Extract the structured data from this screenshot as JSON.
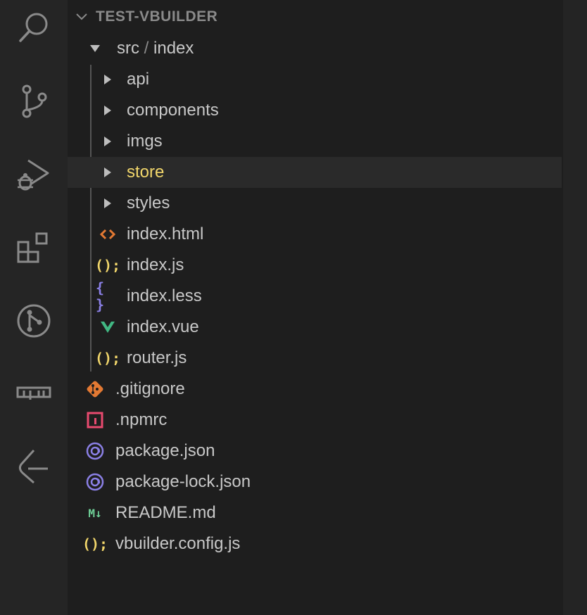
{
  "explorer": {
    "project_title": "TEST-VBUILDER",
    "folder_path": {
      "parent": "src",
      "separator": "/",
      "child": "index"
    },
    "src_children": [
      {
        "label": "api",
        "type": "folder"
      },
      {
        "label": "components",
        "type": "folder"
      },
      {
        "label": "imgs",
        "type": "folder"
      },
      {
        "label": "store",
        "type": "folder"
      },
      {
        "label": "styles",
        "type": "folder"
      },
      {
        "label": "index.html",
        "type": "file",
        "icon": "html-icon"
      },
      {
        "label": "index.js",
        "type": "file",
        "icon": "javascript-icon"
      },
      {
        "label": "index.less",
        "type": "file",
        "icon": "less-icon"
      },
      {
        "label": "index.vue",
        "type": "file",
        "icon": "vue-icon"
      },
      {
        "label": "router.js",
        "type": "file",
        "icon": "javascript-icon"
      }
    ],
    "root_files": [
      {
        "label": ".gitignore",
        "icon": "git-icon"
      },
      {
        "label": ".npmrc",
        "icon": "npm-icon"
      },
      {
        "label": "package.json",
        "icon": "package-icon"
      },
      {
        "label": "package-lock.json",
        "icon": "package-icon"
      },
      {
        "label": "README.md",
        "icon": "markdown-icon"
      },
      {
        "label": "vbuilder.config.js",
        "icon": "javascript-icon"
      }
    ],
    "icon_glyphs": {
      "javascript": "();",
      "less": "{ }",
      "markdown": "M↓"
    }
  },
  "activity_bar": [
    {
      "name": "search-icon"
    },
    {
      "name": "source-control-icon"
    },
    {
      "name": "run-debug-icon"
    },
    {
      "name": "extensions-icon"
    },
    {
      "name": "git-graph-icon"
    },
    {
      "name": "npm-icon"
    },
    {
      "name": "remote-icon"
    }
  ],
  "colors": {
    "background": "#1e1e1e",
    "activity_bar": "#252525",
    "selected_label": "#f1d66b",
    "html": "#e37933",
    "javascript": "#f1d66b",
    "less": "#8b80e6",
    "vue": "#41b883",
    "git": "#e37933",
    "npm": "#e84a6f",
    "package": "#8b80e6",
    "markdown": "#6fcf97"
  }
}
